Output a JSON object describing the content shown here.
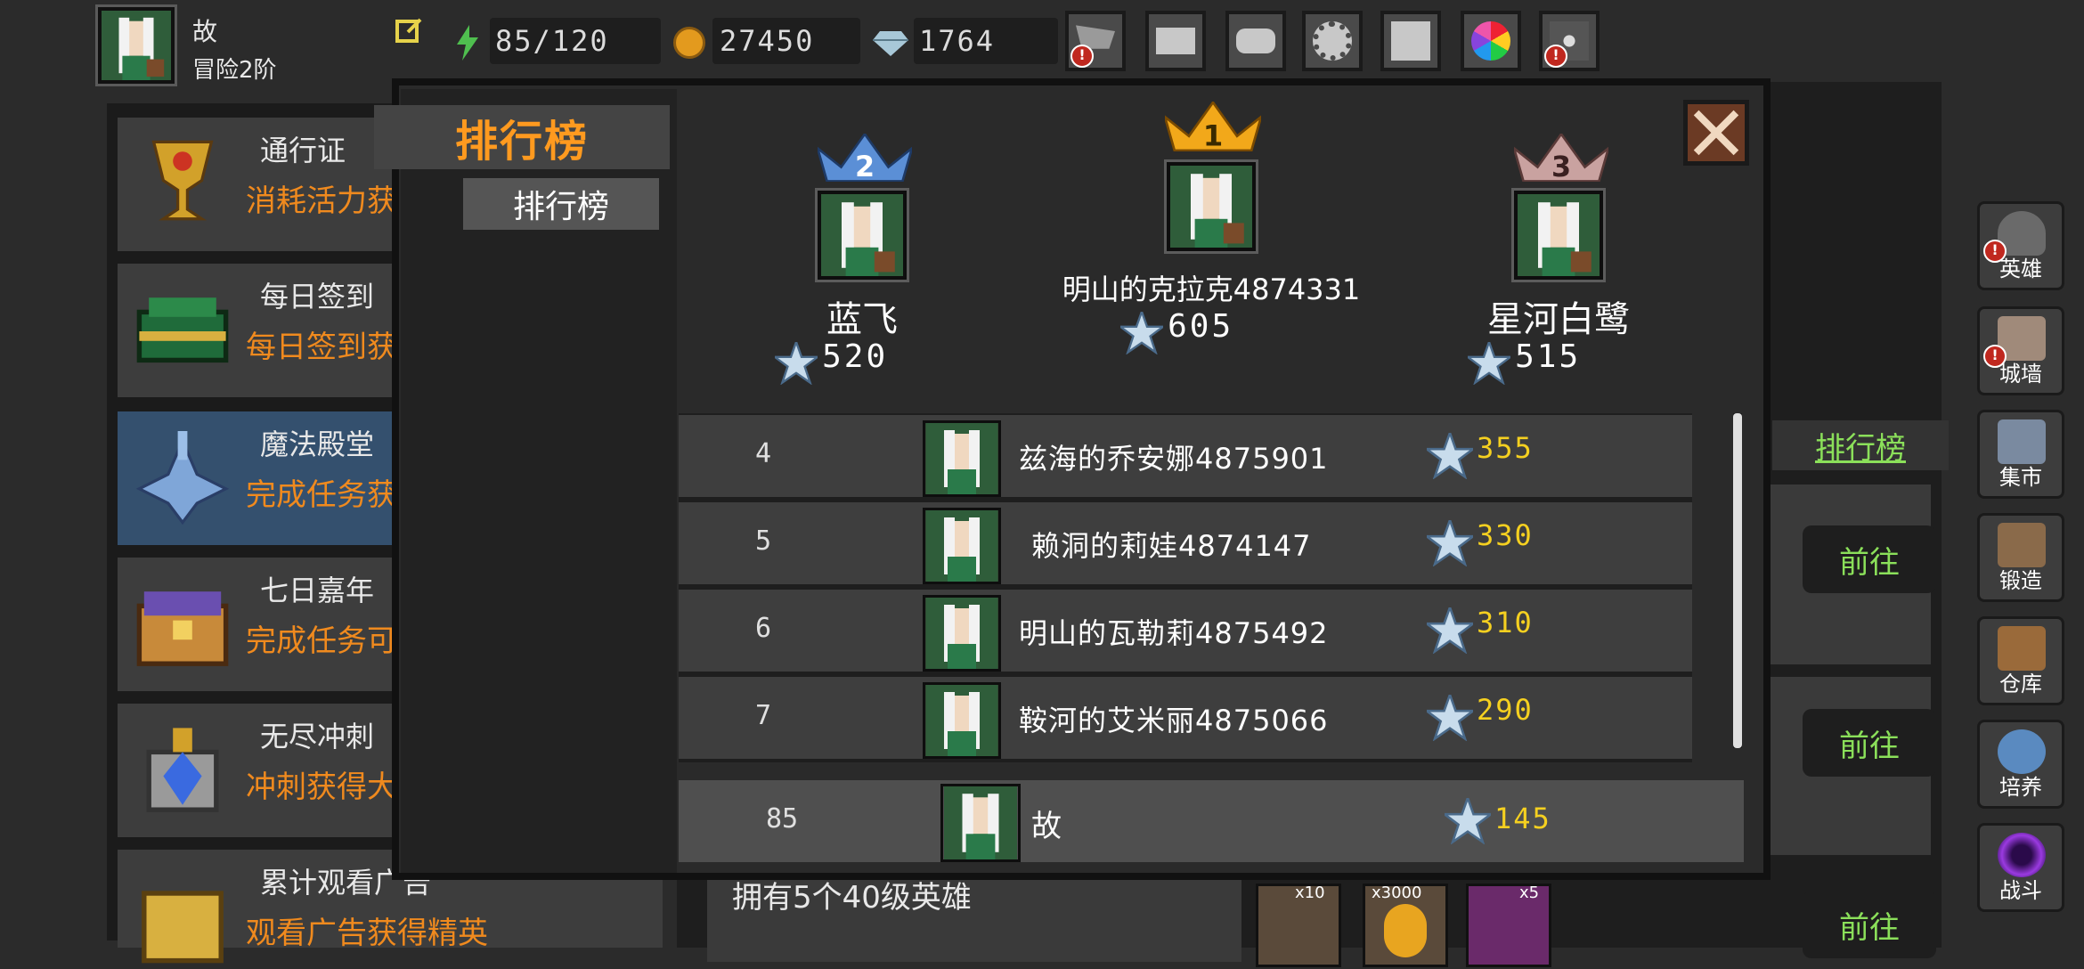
{
  "player": {
    "name": "故",
    "rank": "冒险2阶"
  },
  "resources": {
    "stamina": "85/120",
    "gold": "27450",
    "gems": "1764"
  },
  "top_icons": [
    "cart-icon",
    "mail-icon",
    "gamepad-icon",
    "settings-icon",
    "gift-icon",
    "color-wheel-icon",
    "fireworks-icon"
  ],
  "left_menu": [
    {
      "title": "通行证",
      "sub": "消耗活力获"
    },
    {
      "title": "每日签到",
      "sub": "每日签到获"
    },
    {
      "title": "魔法殿堂",
      "sub": "完成任务获"
    },
    {
      "title": "七日嘉年",
      "sub": "完成任务可"
    },
    {
      "title": "无尽冲刺",
      "sub": "冲刺获得大"
    },
    {
      "title": "累计观看广告",
      "sub": "观看广告获得精英"
    }
  ],
  "right_nav": [
    {
      "label": "英雄"
    },
    {
      "label": "城墙"
    },
    {
      "label": "集市"
    },
    {
      "label": "锻造"
    },
    {
      "label": "仓库"
    },
    {
      "label": "培养"
    },
    {
      "label": "战斗"
    }
  ],
  "bg_panel": {
    "ranking_link": "排行榜",
    "goto": "前往",
    "task_text": "拥有5个40级英雄",
    "rewards": [
      "x10",
      "x3000",
      "x5"
    ]
  },
  "modal": {
    "title_tab": "排行榜",
    "sub_tab": "排行榜",
    "podium": [
      {
        "rank": "2",
        "name": "蓝飞",
        "score": "520"
      },
      {
        "rank": "1",
        "name": "明山的克拉克4874331",
        "score": "605"
      },
      {
        "rank": "3",
        "name": "星河白鹭",
        "score": "515"
      }
    ],
    "rows": [
      {
        "rank": "4",
        "name": "兹海的乔安娜4875901",
        "score": "355"
      },
      {
        "rank": "5",
        "name": "赖洞的莉娃4874147",
        "score": "330"
      },
      {
        "rank": "6",
        "name": "明山的瓦勒莉4875492",
        "score": "310"
      },
      {
        "rank": "7",
        "name": "鞍河的艾米丽4875066",
        "score": "290"
      }
    ],
    "me": {
      "rank": "85",
      "name": "故",
      "score": "145"
    }
  },
  "colors": {
    "accent_orange": "#ff9a1f",
    "score_yellow": "#f5d020",
    "goto_green": "#8be05a",
    "gold_crown": "#f2a81a",
    "silver_crown": "#5b8fd6",
    "bronze_crown": "#c9a2a0"
  }
}
